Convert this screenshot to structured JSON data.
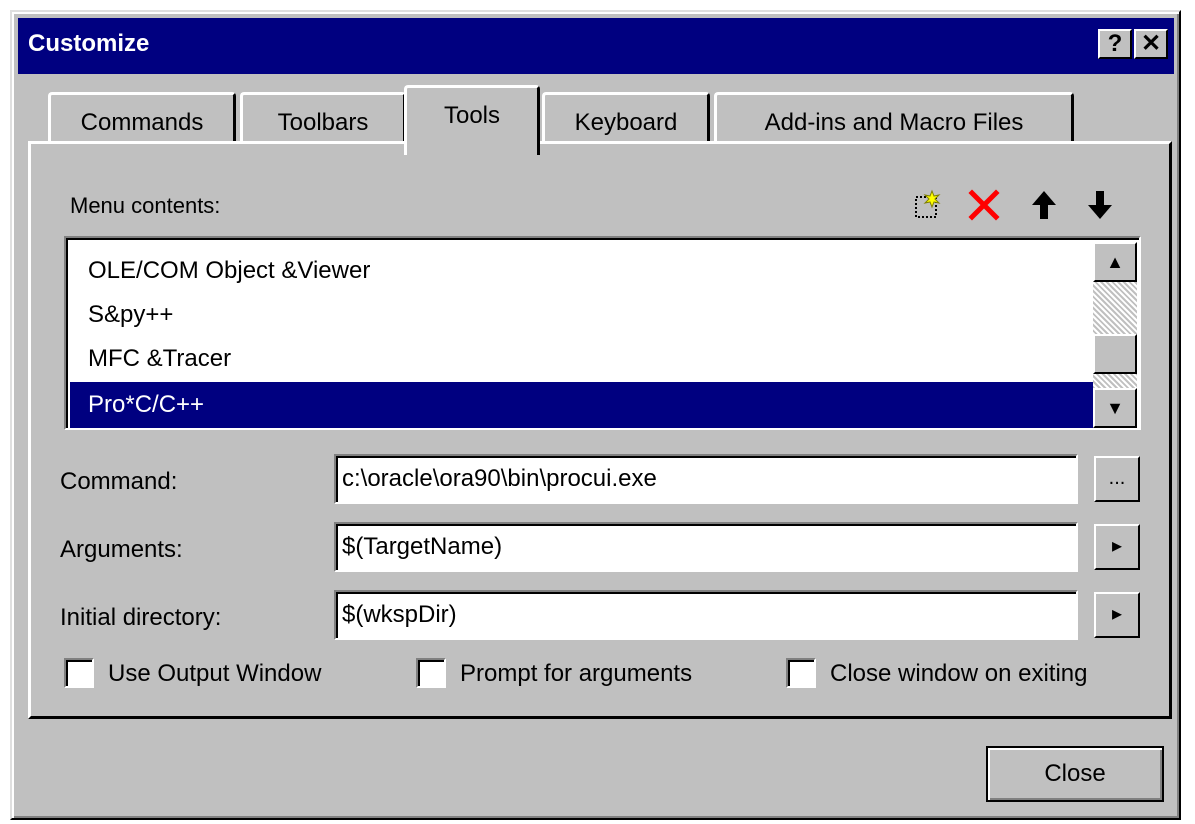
{
  "window": {
    "title": "Customize",
    "help_button": "?",
    "close_button": "✕"
  },
  "tabs": [
    {
      "label": "Commands",
      "active": false
    },
    {
      "label": "Toolbars",
      "active": false
    },
    {
      "label": "Tools",
      "active": true
    },
    {
      "label": "Keyboard",
      "active": false
    },
    {
      "label": "Add-ins and Macro Files",
      "active": false
    }
  ],
  "menu_contents": {
    "label": "Menu contents:",
    "icons": [
      "new-item-icon",
      "delete-icon",
      "move-up-icon",
      "move-down-icon"
    ],
    "items": [
      {
        "label": "OLE/COM Object &Viewer",
        "selected": false
      },
      {
        "label": "S&py++",
        "selected": false
      },
      {
        "label": "MFC &Tracer",
        "selected": false
      },
      {
        "label": "Pro*C/C++",
        "selected": true
      }
    ]
  },
  "fields": {
    "command": {
      "label": "Command:",
      "value": "c:\\oracle\\ora90\\bin\\procui.exe",
      "button": "..."
    },
    "arguments": {
      "label": "Arguments:",
      "value": "$(TargetName)",
      "button": "▸"
    },
    "initial_directory": {
      "label": "Initial directory:",
      "value": "$(wkspDir)",
      "button": "▸"
    }
  },
  "checkboxes": [
    {
      "label": "Use Output Window",
      "checked": false
    },
    {
      "label": "Prompt for arguments",
      "checked": false
    },
    {
      "label": "Close window on exiting",
      "checked": false
    }
  ],
  "footer": {
    "close_label": "Close"
  },
  "colors": {
    "title_bar": "#000080",
    "face": "#c0c0c0",
    "selection": "#000080"
  }
}
